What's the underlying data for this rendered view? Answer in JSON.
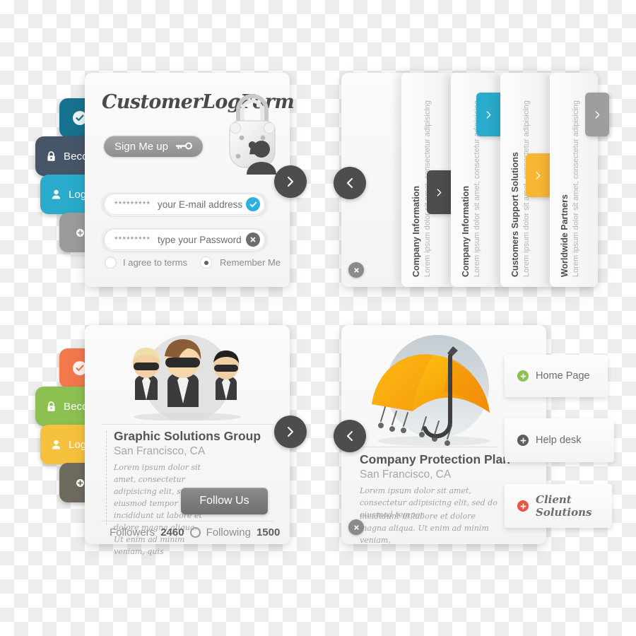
{
  "login_card": {
    "brand": "CustomerLogForm",
    "signup_button": "Sign Me up",
    "key_icon": "key-icon",
    "lock_icon": "padlock-illustration",
    "email_field": {
      "masked": "*********",
      "placeholder": "your E-mail address",
      "status_icon": "check-circle-icon",
      "status_color": "#2cb0dd"
    },
    "password_field": {
      "masked": "*********",
      "placeholder": "type your Password",
      "status_icon": "close-circle-icon",
      "status_color": "#6d6d6d"
    },
    "terms_label": "I agree to terms",
    "remember_label": "Remember Me",
    "next_arrow": "chevron-right-icon",
    "tabs": [
      {
        "label": "",
        "icon": "check-circle-icon",
        "color": "#17728f",
        "style": "badge"
      },
      {
        "label": "Become a",
        "icon": "lock-icon",
        "color": "#475569",
        "style": "text"
      },
      {
        "label": "Log In",
        "icon": "user-icon",
        "color": "#2aabcb",
        "style": "text-pointed"
      },
      {
        "label": "",
        "icon": "plus-circle-icon",
        "color": "#9b9b9b",
        "style": "badge"
      }
    ]
  },
  "accordion_card": {
    "prev_arrow": "chevron-left-icon",
    "close_icon": "close-icon",
    "panels": [
      {
        "title": "Company Information",
        "subtitle": "Lorem ipsum dolor sit amet, consectetur adipisicing",
        "tab_color": "#4d4d4d",
        "tab_arrow": "chevron-right-icon"
      },
      {
        "title": "Company Information",
        "subtitle": "Lorem ipsum dolor sit amet, consectetur adipisicing",
        "tab_color": "#2aabcb",
        "tab_arrow": "chevron-right-icon"
      },
      {
        "title": "Customers Support Solutions",
        "subtitle": "Lorem ipsum dolor sit amet, consectetur adipisicing",
        "tab_color": "#f7b733",
        "tab_arrow": "chevron-right-icon"
      },
      {
        "title": "Worldwide Partners",
        "subtitle": "Lorem ipsum dolor sit amet, consectetur adipisicing",
        "tab_color": "#9e9e9e",
        "tab_arrow": "chevron-right-icon"
      }
    ]
  },
  "team_card": {
    "photo_alt": "three-businessmen-illustration",
    "title": "Graphic Solutions Group",
    "location": "San Francisco, CA",
    "body": "Lorem ipsum dolor sit amet, consectetur adipisicing elit, sed do eiusmod tempor incididunt ut labore et dolore magna aliqua. Ut enim ad minim veniam, quis",
    "follow_button": "Follow Us",
    "followers_label": "Followers",
    "followers_count": "2460",
    "following_label": "Following",
    "following_count": "1500",
    "next_arrow": "chevron-right-icon",
    "tabs": [
      {
        "label": "",
        "icon": "check-circle-icon",
        "color": "#f3784b",
        "style": "badge"
      },
      {
        "label": "Become a",
        "icon": "lock-icon",
        "color": "#8cc152",
        "style": "text"
      },
      {
        "label": "Log In",
        "icon": "user-icon",
        "color": "#f6c23e",
        "style": "text-pointed"
      },
      {
        "label": "",
        "icon": "plus-circle-icon",
        "color": "#6e6a5e",
        "style": "badge"
      }
    ]
  },
  "plan_card": {
    "photo_alt": "yellow-umbrella-illustration",
    "title": "Company Protection Plan",
    "location": "San Francisco, CA",
    "body_1": "Lorem ipsum dolor sit amet, consectetur adipisicing elit, sed do eiusmod tempor",
    "body_2": "incididunt ut labore et dolore magna aliqua. Ut enim ad minim veniam,",
    "prev_arrow": "chevron-left-icon",
    "close_icon": "close-icon",
    "menu": [
      {
        "label": "Home Page",
        "icon": "plus-circle-icon",
        "color": "#8cc152",
        "fancy": false
      },
      {
        "label": "Help desk",
        "icon": "plus-circle-icon",
        "color": "#5d5d5d",
        "fancy": false
      },
      {
        "label": "Client Solutions",
        "icon": "plus-circle-icon",
        "color": "#e8573f",
        "fancy": true
      }
    ]
  }
}
